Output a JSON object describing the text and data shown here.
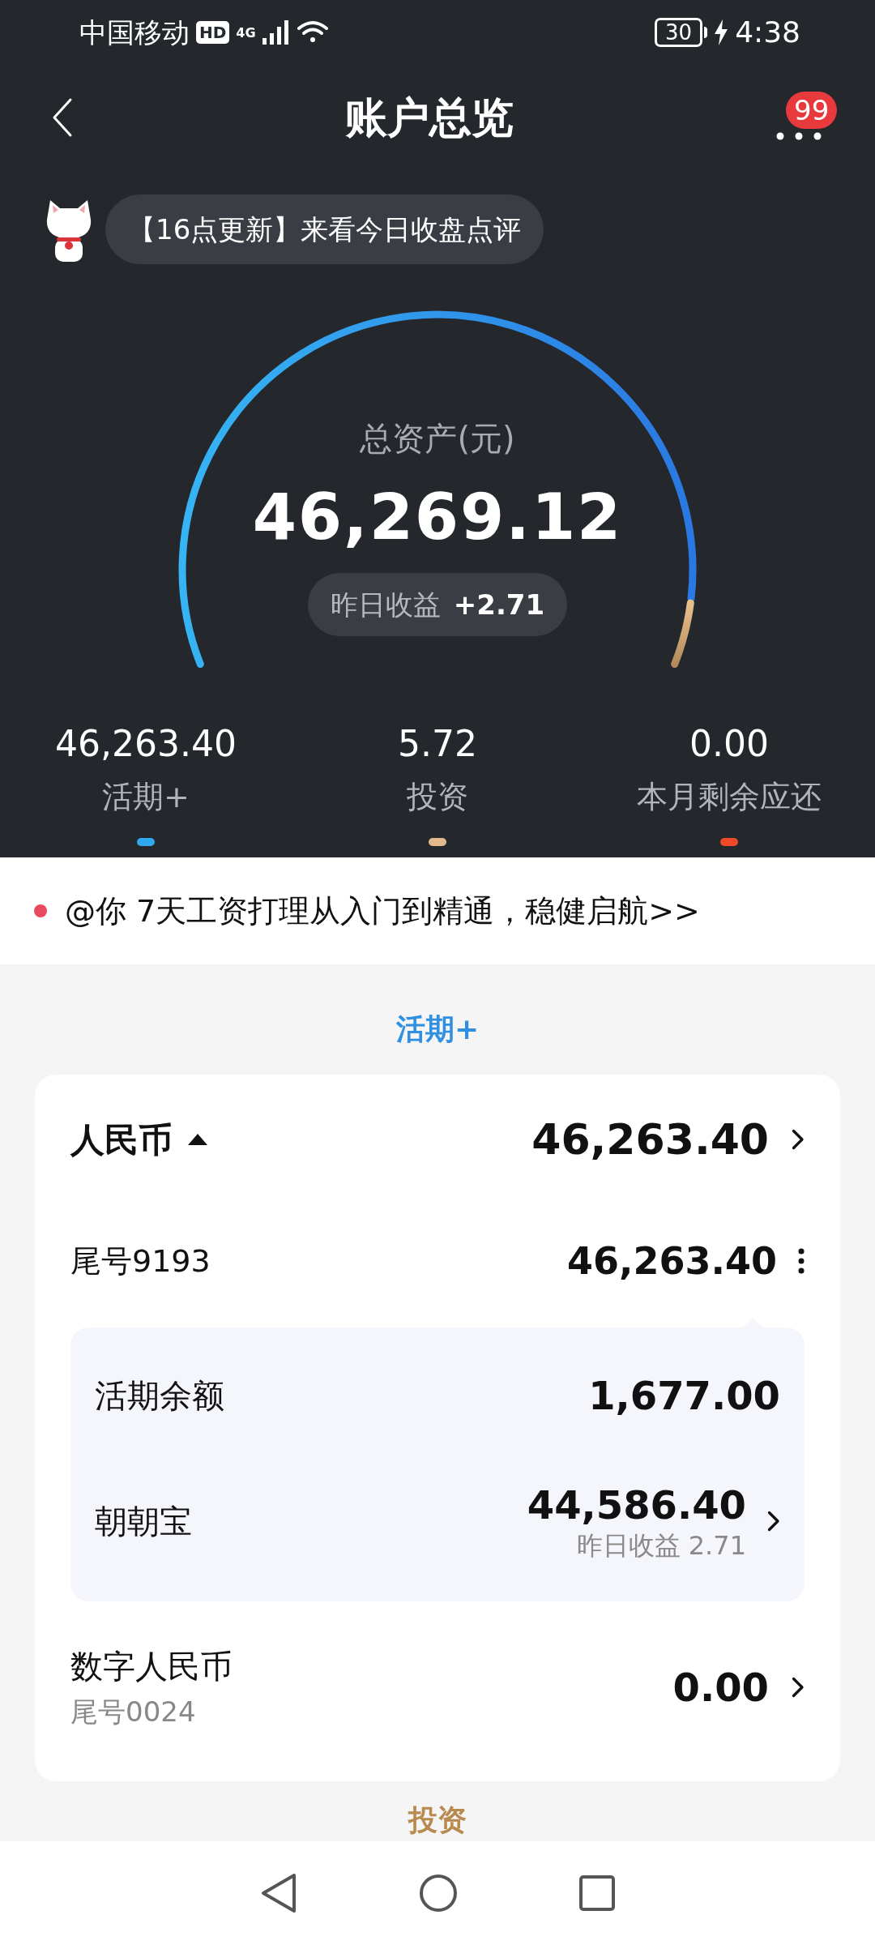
{
  "status_bar": {
    "carrier": "中国移动",
    "hd": "HD",
    "network": "4G",
    "battery": "30",
    "time": "4:38"
  },
  "header": {
    "title": "账户总览",
    "badge": "99"
  },
  "banner": {
    "text": "【16点更新】来看今日收盘点评"
  },
  "gauge": {
    "label": "总资产(元)",
    "total": "46,269.12",
    "yesterday_label": "昨日收益",
    "yesterday_value": "+2.71"
  },
  "summary": [
    {
      "value": "46,263.40",
      "label": "活期+",
      "color": "#2fa8ee"
    },
    {
      "value": "5.72",
      "label": "投资",
      "color": "#e1b98c"
    },
    {
      "value": "0.00",
      "label": "本月剩余应还",
      "color": "#f04a2a"
    }
  ],
  "notice": {
    "text": "@你 7天工资打理从入门到精通，稳健启航>>"
  },
  "section_title": "活期+",
  "currency": {
    "name": "人民币",
    "expanded": true,
    "amount": "46,263.40"
  },
  "account": {
    "name": "尾号9193",
    "amount": "46,263.40",
    "items": [
      {
        "kind": "plain",
        "name": "活期余额",
        "amount": "1,677.00"
      },
      {
        "kind": "detail",
        "name": "朝朝宝",
        "amount": "44,586.40",
        "note": "昨日收益 2.71"
      }
    ]
  },
  "digital": {
    "name": "数字人民币",
    "sub": "尾号0024",
    "amount": "0.00"
  },
  "next_section": "投资"
}
